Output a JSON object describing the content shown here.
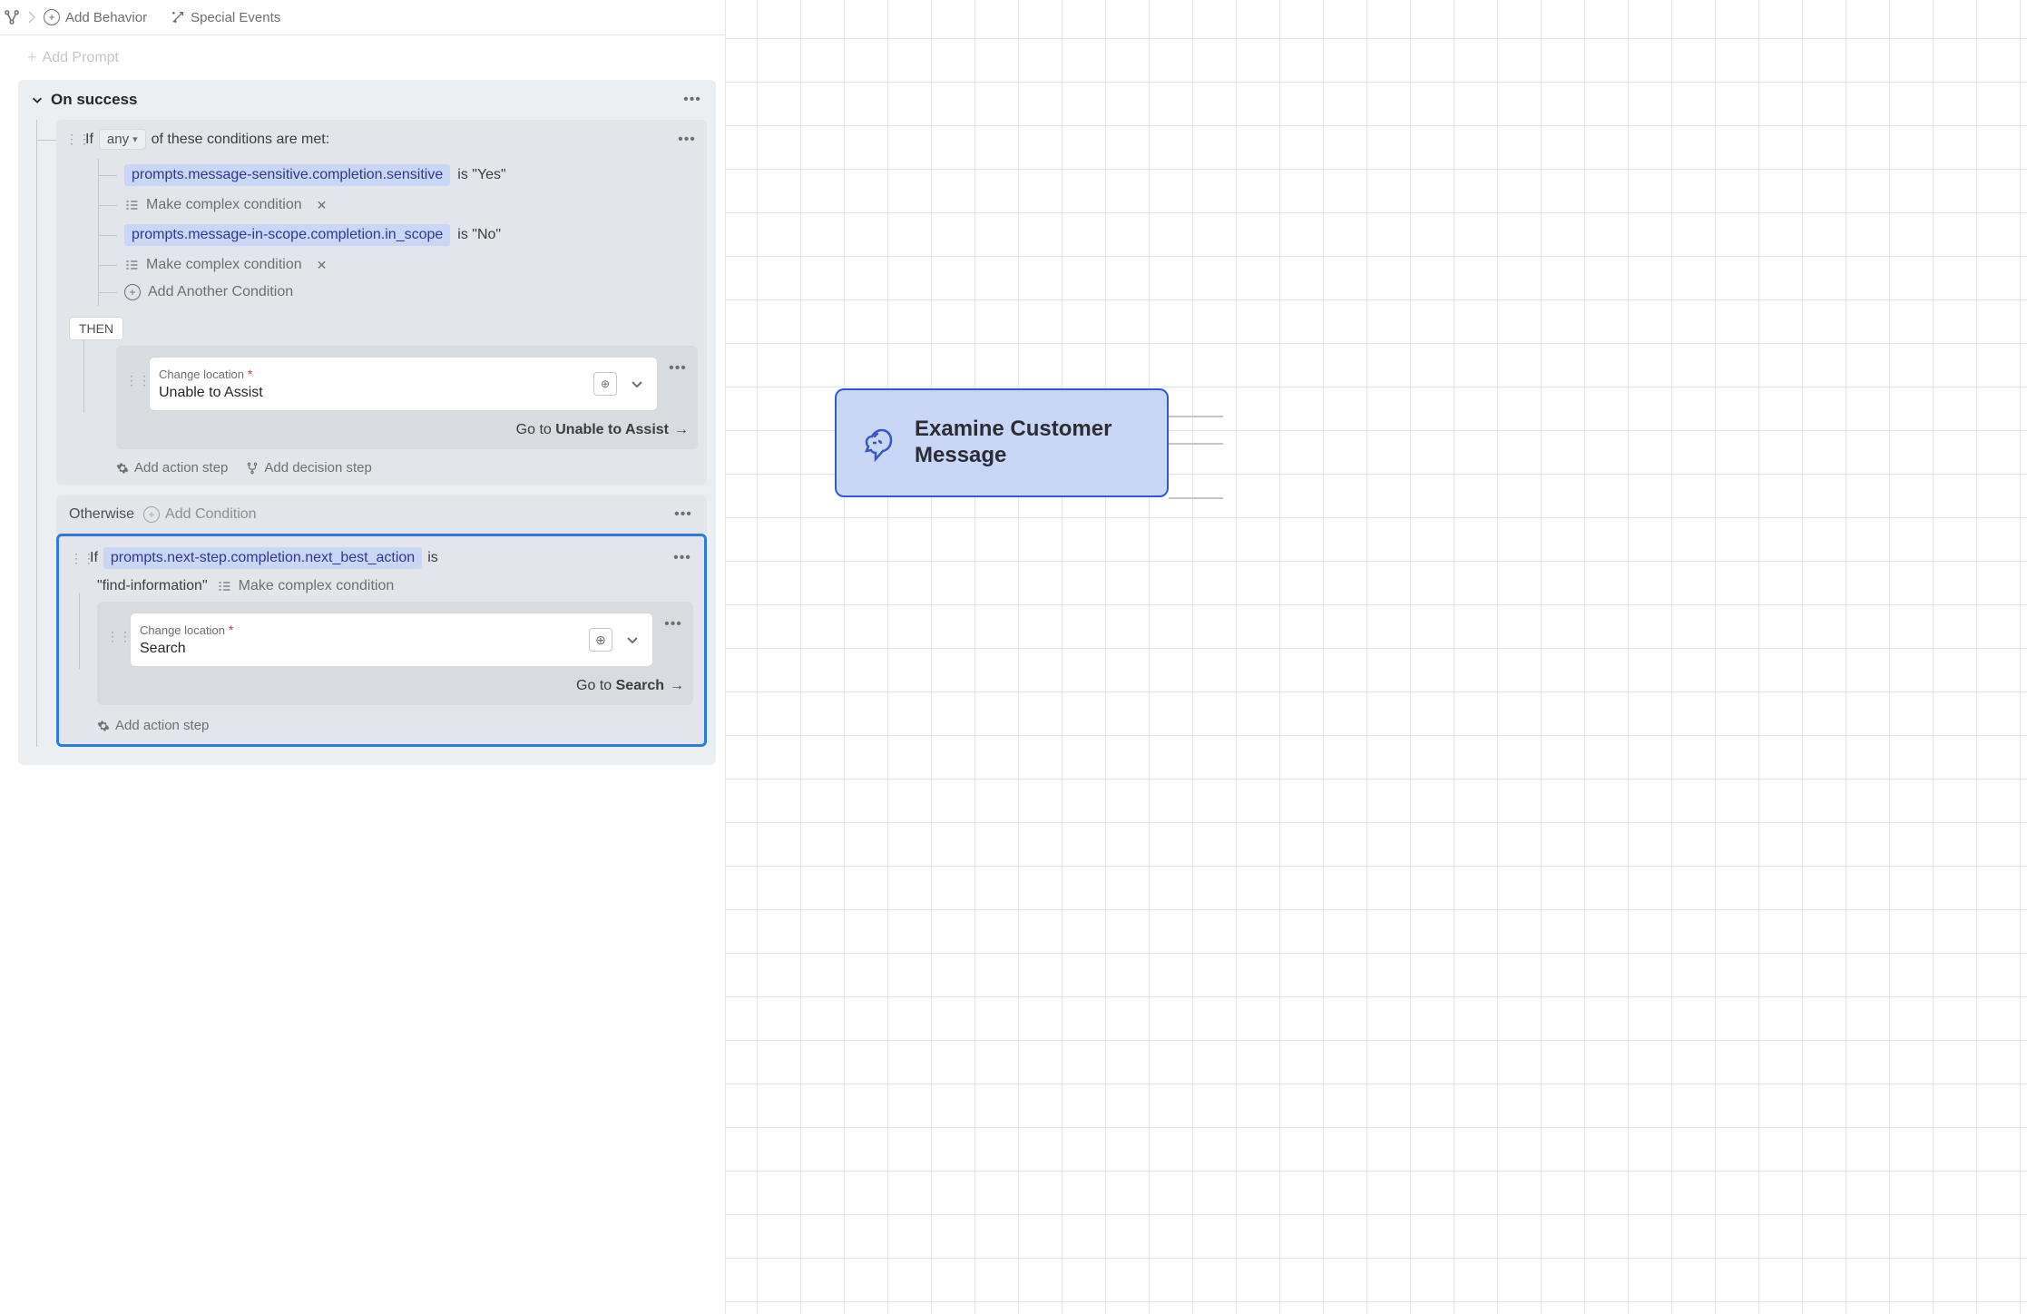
{
  "toolbar": {
    "add_behavior": "Add Behavior",
    "special_events": "Special Events"
  },
  "faded_add": "Add Prompt",
  "section": {
    "title": "On success",
    "if_prefix": "If",
    "quantifier": "any",
    "if_suffix": "of these conditions are met:",
    "conditions": [
      {
        "token": "prompts.message-sensitive.completion.sensitive",
        "text": "is \"Yes\""
      },
      {
        "token": "prompts.message-in-scope.completion.in_scope",
        "text": "is \"No\""
      }
    ],
    "make_complex": "Make complex condition",
    "add_another": "Add Another Condition",
    "then_label": "THEN",
    "change_location_label": "Change location",
    "change_location_value": "Unable to Assist",
    "goto_prefix": "Go to ",
    "goto_target": "Unable to Assist",
    "add_action": "Add action step",
    "add_decision": "Add decision step",
    "otherwise_label": "Otherwise",
    "add_condition": "Add Condition",
    "block2": {
      "if_prefix": "If",
      "token": "prompts.next-step.completion.next_best_action",
      "op": "is",
      "value": "\"find-information\"",
      "make_complex": "Make complex condition",
      "change_location_label": "Change location",
      "change_location_value": "Search",
      "goto_prefix": "Go to ",
      "goto_target": "Search",
      "add_action": "Add action step"
    }
  },
  "flow": {
    "node_title": "Examine Customer Message"
  }
}
